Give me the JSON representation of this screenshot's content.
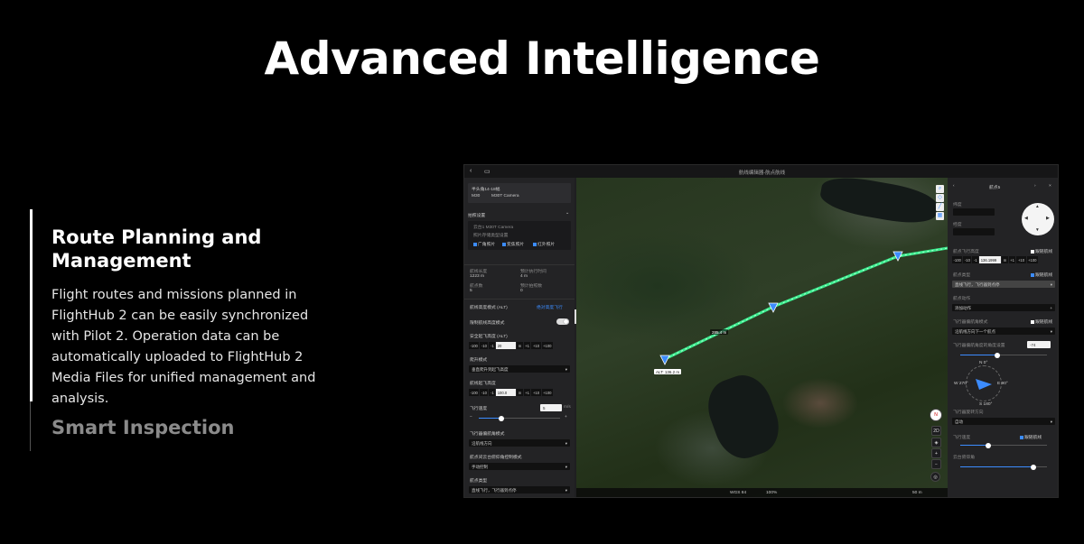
{
  "page": {
    "title": "Advanced Intelligence"
  },
  "sidebar": {
    "active_title": "Route Planning and Management",
    "active_body": "Flight routes and missions planned in FlightHub 2 can be easily synchronized with Pilot 2. Operation data can be automatically uploaded to FlightHub 2 Media Files for unified management and analysis.",
    "next_title": "Smart Inspection"
  },
  "app": {
    "window_title": "航线编辑器-航点航线",
    "left_panel": {
      "route_name": "半头角14-18幅",
      "drone_model": "M30",
      "camera_model": "M30T Camera",
      "section_shoot": "拍照设置",
      "camera_setting": "云台1 M30T Camera",
      "photo_storage": "照片存储类型设置",
      "chk_wide": "广角照片",
      "chk_zoom": "变焦照片",
      "chk_ir": "红外照片",
      "stat_length_label": "航线长度",
      "stat_length_value": "1223 m",
      "stat_time_label": "预计执行时间",
      "stat_time_value": "4 m",
      "stat_points_label": "航点数",
      "stat_points_value": "5",
      "stat_photos_label": "预计拍照数",
      "stat_photos_value": "0",
      "alt_mode_label": "航线高度模式 (ALT)",
      "alt_mode_link": "绝对高度飞行",
      "safe_takeoff_label": "限制航线高度模式",
      "safe_alt_label": "安全起飞高度 (ALT)",
      "safe_alt_value": "20",
      "climb_mode_label": "爬升模式",
      "climb_mode_value": "垂直爬升到起飞高度",
      "climb_alt_label": "航线起飞高度",
      "climb_alt_value": "100.0",
      "speed_label": "飞行速度",
      "speed_value": "5",
      "speed_unit": "m/s",
      "heading_label": "飞行器偏航角模式",
      "heading_value": "沿航线方向",
      "gimbal_label": "航点间云台俯仰角控制模式",
      "gimbal_value": "手动控制",
      "type_label": "航点类型",
      "type_value": "直线飞行，飞行器到点停",
      "unit_m": "m",
      "step_minus100": "-100",
      "step_minus10": "-10",
      "step_minus1": "-1",
      "step_plus1": "+1",
      "step_plus10": "+10",
      "step_plus100": "+100"
    },
    "map": {
      "label_alt": "ALT: 136.2 m",
      "label_dist": "285.4 m",
      "status_coord": "WGS 84",
      "status_zoom": "100%",
      "scale": "50 m",
      "mode_2d": "2D",
      "north": "N"
    },
    "right_panel": {
      "title": "航点5",
      "lat_label": "纬度",
      "lon_label": "经度",
      "alt_label": "航点飞行高度",
      "alt_value": "136.1999",
      "follow_label": "跟随航线",
      "speed_label": "航点类型",
      "speed_value": "直线飞行，飞行器到点停",
      "action_label": "航点动作",
      "action_value": "添加动作",
      "yaw_mode_label": "飞行器偏航角模式",
      "yaw_mode_value": "沿航线方向下一个航点",
      "yaw_angle_label": "飞行器偏航角度的角度设置",
      "yaw_angle_value": "-74",
      "compass_n": "N 0°",
      "compass_e": "E 90°",
      "compass_s": "S 180°",
      "compass_w": "W 270°",
      "turn_label": "飞行器旋转方向",
      "turn_value": "自动",
      "gimbal_speed_label": "飞行速度",
      "gimbal_pitch_label": "云台俯仰角",
      "nav_prev": "‹",
      "nav_next": "›",
      "close": "×"
    }
  },
  "colors": {
    "accent": "#3c8cff",
    "route_line": "#3dff9a",
    "background": "#000000"
  }
}
